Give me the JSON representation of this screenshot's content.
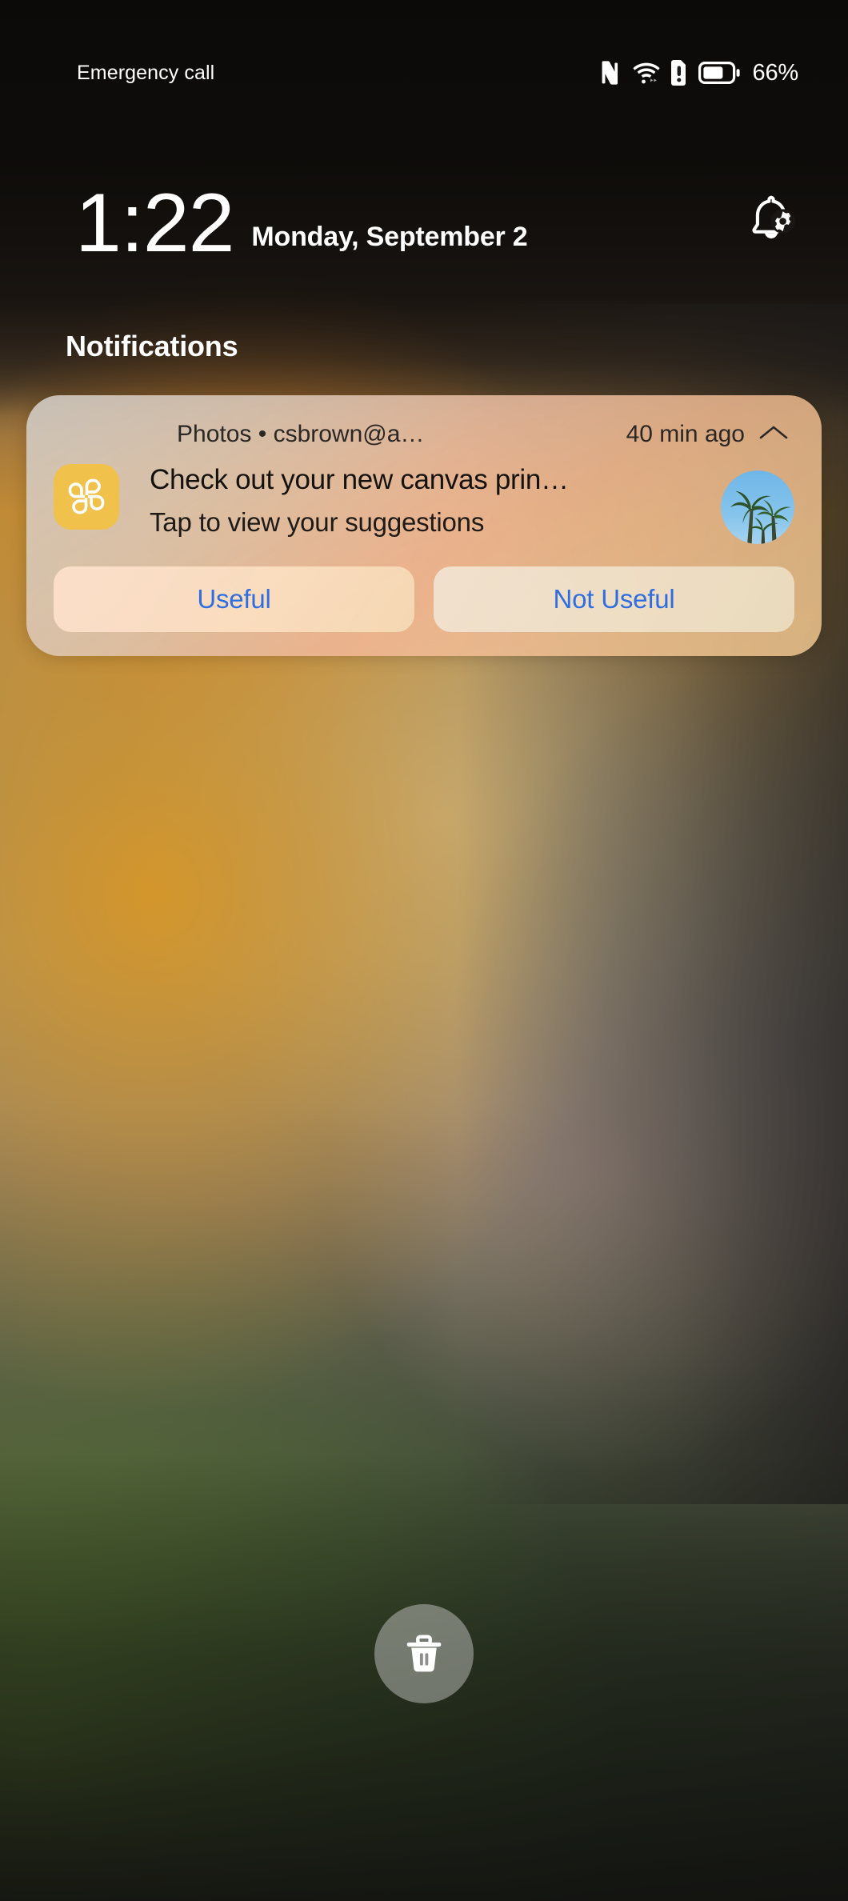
{
  "status_bar": {
    "emergency_call": "Emergency call",
    "battery_percent": "66%",
    "icons": [
      "nfc-icon",
      "wifi-icon",
      "sim-alert-icon",
      "battery-icon"
    ],
    "battery_level": 66
  },
  "lock_screen": {
    "time": "1:22",
    "date": "Monday, September 2",
    "notification_settings_icon": "bell-gear-icon",
    "notifications_heading": "Notifications"
  },
  "notification": {
    "source": "Photos • csbrown@a…",
    "timestamp": "40 min ago",
    "collapse_icon": "chevron-up-icon",
    "app_icon": "google-photos-pinwheel-icon",
    "title": "Check out your new canvas prin…",
    "text": "Tap to view your suggestions",
    "thumbnail": "palm-trees-photo-thumbnail",
    "actions": [
      {
        "label": "Useful",
        "name": "useful-button"
      },
      {
        "label": "Not Useful",
        "name": "not-useful-button"
      }
    ]
  },
  "bottom_bar": {
    "delete_icon": "trash-icon"
  },
  "colors": {
    "action_text": "#2f6ee0",
    "app_icon_bg": "#f0c14b",
    "status_text": "#ffffff",
    "notification_text": "#14120f"
  }
}
